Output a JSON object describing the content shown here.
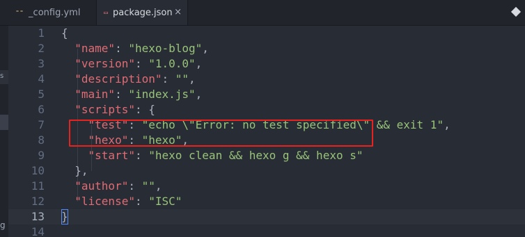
{
  "tabs": [
    {
      "label": "_config.yml",
      "icon": "yml-file-icon",
      "active": false
    },
    {
      "label": "package.json",
      "icon": "json-file-icon",
      "active": true,
      "close": "×"
    }
  ],
  "left_panel": {
    "fragments": [
      "s",
      "g"
    ]
  },
  "editor": {
    "active_line": 13,
    "lines": [
      {
        "num": "1",
        "tokens": [
          {
            "t": "{",
            "c": "p"
          }
        ]
      },
      {
        "num": "2",
        "tokens": [
          {
            "t": "  "
          },
          {
            "t": "\"name\"",
            "c": "k"
          },
          {
            "t": ": ",
            "c": "p"
          },
          {
            "t": "\"hexo-blog\"",
            "c": "s"
          },
          {
            "t": ",",
            "c": "p"
          }
        ]
      },
      {
        "num": "3",
        "tokens": [
          {
            "t": "  "
          },
          {
            "t": "\"version\"",
            "c": "k"
          },
          {
            "t": ": ",
            "c": "p"
          },
          {
            "t": "\"1.0.0\"",
            "c": "s"
          },
          {
            "t": ",",
            "c": "p"
          }
        ]
      },
      {
        "num": "4",
        "tokens": [
          {
            "t": "  "
          },
          {
            "t": "\"description\"",
            "c": "k"
          },
          {
            "t": ": ",
            "c": "p"
          },
          {
            "t": "\"\"",
            "c": "s"
          },
          {
            "t": ",",
            "c": "p"
          }
        ]
      },
      {
        "num": "5",
        "tokens": [
          {
            "t": "  "
          },
          {
            "t": "\"main\"",
            "c": "k"
          },
          {
            "t": ": ",
            "c": "p"
          },
          {
            "t": "\"index.js\"",
            "c": "s"
          },
          {
            "t": ",",
            "c": "p"
          }
        ]
      },
      {
        "num": "6",
        "tokens": [
          {
            "t": "  "
          },
          {
            "t": "\"scripts\"",
            "c": "k"
          },
          {
            "t": ": {",
            "c": "p"
          }
        ]
      },
      {
        "num": "7",
        "tokens": [
          {
            "t": "    "
          },
          {
            "t": "\"test\"",
            "c": "k"
          },
          {
            "t": ": ",
            "c": "p"
          },
          {
            "t": "\"echo \\\"Error: no test specified\\\" && exit 1\"",
            "c": "s"
          },
          {
            "t": ",",
            "c": "p"
          }
        ]
      },
      {
        "num": "8",
        "tokens": [
          {
            "t": "    "
          },
          {
            "t": "\"hexo\"",
            "c": "k"
          },
          {
            "t": ": ",
            "c": "p"
          },
          {
            "t": "\"hexo\"",
            "c": "s"
          },
          {
            "t": ",",
            "c": "p"
          }
        ]
      },
      {
        "num": "9",
        "tokens": [
          {
            "t": "    "
          },
          {
            "t": "\"start\"",
            "c": "k"
          },
          {
            "t": ": ",
            "c": "p"
          },
          {
            "t": "\"hexo clean && hexo g && hexo s\"",
            "c": "s"
          }
        ]
      },
      {
        "num": "10",
        "tokens": [
          {
            "t": "  },",
            "c": "p"
          }
        ]
      },
      {
        "num": "11",
        "tokens": [
          {
            "t": "  "
          },
          {
            "t": "\"author\"",
            "c": "k"
          },
          {
            "t": ": ",
            "c": "p"
          },
          {
            "t": "\"\"",
            "c": "s"
          },
          {
            "t": ",",
            "c": "p"
          }
        ]
      },
      {
        "num": "12",
        "tokens": [
          {
            "t": "  "
          },
          {
            "t": "\"license\"",
            "c": "k"
          },
          {
            "t": ": ",
            "c": "p"
          },
          {
            "t": "\"ISC\"",
            "c": "s"
          }
        ]
      },
      {
        "num": "13",
        "tokens": [
          {
            "t": "}",
            "c": "p"
          }
        ]
      },
      {
        "num": "14",
        "tokens": []
      }
    ]
  },
  "colors": {
    "key": "#e06c75",
    "string": "#98c379",
    "highlight_border": "#e8231f",
    "background": "#282c34"
  }
}
